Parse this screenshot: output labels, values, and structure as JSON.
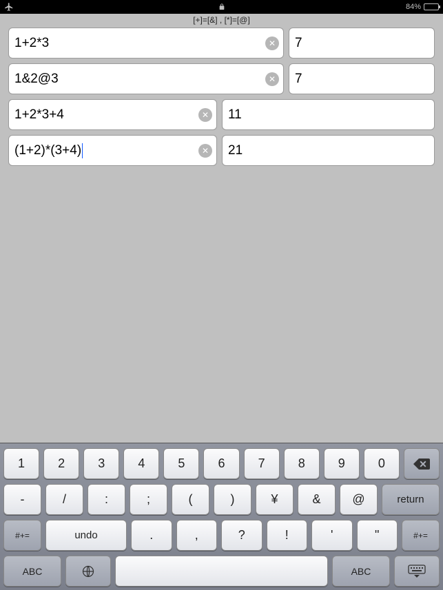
{
  "statusbar": {
    "battery_pct": "84%"
  },
  "hint": "[+]=[&] ,  [*]=[@]",
  "rows": [
    {
      "layout": "a",
      "expr": "1+2*3",
      "res": "7",
      "active": false
    },
    {
      "layout": "a",
      "expr": "1&2@3",
      "res": "7",
      "active": false
    },
    {
      "layout": "b",
      "expr": "1+2*3+4",
      "res": "11",
      "active": false
    },
    {
      "layout": "b",
      "expr": "(1+2)*(3+4)",
      "res": "21",
      "active": true
    }
  ],
  "keyboard": {
    "row1": [
      "1",
      "2",
      "3",
      "4",
      "5",
      "6",
      "7",
      "8",
      "9",
      "0"
    ],
    "backspace": "⌫",
    "row2": [
      "-",
      "/",
      ":",
      ";",
      "(",
      ")",
      "¥",
      "&",
      "@"
    ],
    "return": "return",
    "special": "#+=",
    "undo": "undo",
    "row3": [
      ".",
      ",",
      "?",
      "!",
      "'",
      "\""
    ],
    "abc": "ABC",
    "space": " "
  }
}
